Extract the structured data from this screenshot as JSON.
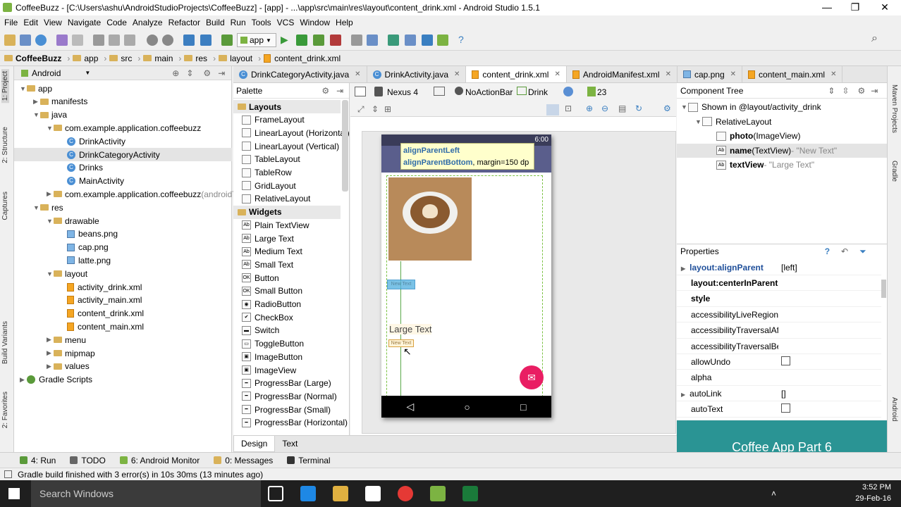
{
  "window": {
    "title": "CoffeeBuzz - [C:\\Users\\ashu\\AndroidStudioProjects\\CoffeeBuzz] - [app] - ...\\app\\src\\main\\res\\layout\\content_drink.xml - Android Studio 1.5.1",
    "minimize": "—",
    "maximize": "❐",
    "close": "✕"
  },
  "menu": [
    "File",
    "Edit",
    "View",
    "Navigate",
    "Code",
    "Analyze",
    "Refactor",
    "Build",
    "Run",
    "Tools",
    "VCS",
    "Window",
    "Help"
  ],
  "toolbar": {
    "run_config": "app"
  },
  "breadcrumb": [
    "CoffeeBuzz",
    "app",
    "src",
    "main",
    "res",
    "layout",
    "content_drink.xml"
  ],
  "left_tool_tabs": [
    "1: Project",
    "2: Structure",
    "Captures",
    "Build Variants",
    "2: Favorites"
  ],
  "right_tool_tabs": [
    "Maven Projects",
    "Gradle",
    "Android"
  ],
  "project": {
    "view": "Android",
    "tree": [
      {
        "label": "app",
        "depth": 0,
        "kind": "folder",
        "arrow": "▼"
      },
      {
        "label": "manifests",
        "depth": 1,
        "kind": "folder",
        "arrow": "▶"
      },
      {
        "label": "java",
        "depth": 1,
        "kind": "folder",
        "arrow": "▼"
      },
      {
        "label": "com.example.application.coffeebuzz",
        "depth": 2,
        "kind": "folder",
        "arrow": "▼"
      },
      {
        "label": "DrinkActivity",
        "depth": 3,
        "kind": "class",
        "arrow": ""
      },
      {
        "label": "DrinkCategoryActivity",
        "depth": 3,
        "kind": "class",
        "arrow": "",
        "selected": true
      },
      {
        "label": "Drinks",
        "depth": 3,
        "kind": "class",
        "arrow": ""
      },
      {
        "label": "MainActivity",
        "depth": 3,
        "kind": "class",
        "arrow": ""
      },
      {
        "label": "com.example.application.coffeebuzz",
        "suffix": " (androidTest)",
        "depth": 2,
        "kind": "folder",
        "arrow": "▶"
      },
      {
        "label": "res",
        "depth": 1,
        "kind": "folder",
        "arrow": "▼"
      },
      {
        "label": "drawable",
        "depth": 2,
        "kind": "folder",
        "arrow": "▼"
      },
      {
        "label": "beans.png",
        "depth": 3,
        "kind": "file",
        "arrow": ""
      },
      {
        "label": "cap.png",
        "depth": 3,
        "kind": "file",
        "arrow": ""
      },
      {
        "label": "latte.png",
        "depth": 3,
        "kind": "file",
        "arrow": ""
      },
      {
        "label": "layout",
        "depth": 2,
        "kind": "folder",
        "arrow": "▼"
      },
      {
        "label": "activity_drink.xml",
        "depth": 3,
        "kind": "xml",
        "arrow": ""
      },
      {
        "label": "activity_main.xml",
        "depth": 3,
        "kind": "xml",
        "arrow": ""
      },
      {
        "label": "content_drink.xml",
        "depth": 3,
        "kind": "xml",
        "arrow": ""
      },
      {
        "label": "content_main.xml",
        "depth": 3,
        "kind": "xml",
        "arrow": ""
      },
      {
        "label": "menu",
        "depth": 2,
        "kind": "folder",
        "arrow": "▶"
      },
      {
        "label": "mipmap",
        "depth": 2,
        "kind": "folder",
        "arrow": "▶"
      },
      {
        "label": "values",
        "depth": 2,
        "kind": "folder",
        "arrow": "▶"
      },
      {
        "label": "Gradle Scripts",
        "depth": 0,
        "kind": "gradle",
        "arrow": "▶"
      }
    ]
  },
  "editor_tabs": [
    {
      "label": "DrinkCategoryActivity.java",
      "active": false
    },
    {
      "label": "DrinkActivity.java",
      "active": false
    },
    {
      "label": "content_drink.xml",
      "active": true
    },
    {
      "label": "AndroidManifest.xml",
      "active": false
    },
    {
      "label": "cap.png",
      "active": false
    },
    {
      "label": "content_main.xml",
      "active": false
    }
  ],
  "palette": {
    "title": "Palette",
    "items": [
      {
        "label": "Layouts",
        "group": true
      },
      {
        "label": "FrameLayout"
      },
      {
        "label": "LinearLayout (Horizontal)"
      },
      {
        "label": "LinearLayout (Vertical)"
      },
      {
        "label": "TableLayout"
      },
      {
        "label": "TableRow"
      },
      {
        "label": "GridLayout"
      },
      {
        "label": "RelativeLayout"
      },
      {
        "label": "Widgets",
        "group": true
      },
      {
        "label": "Plain TextView",
        "icon": "Ab"
      },
      {
        "label": "Large Text",
        "icon": "Ab"
      },
      {
        "label": "Medium Text",
        "icon": "Ab"
      },
      {
        "label": "Small Text",
        "icon": "Ab"
      },
      {
        "label": "Button",
        "icon": "OK"
      },
      {
        "label": "Small Button",
        "icon": "OK"
      },
      {
        "label": "RadioButton",
        "icon": "◉"
      },
      {
        "label": "CheckBox",
        "icon": "✔"
      },
      {
        "label": "Switch",
        "icon": "▬"
      },
      {
        "label": "ToggleButton",
        "icon": "▭"
      },
      {
        "label": "ImageButton",
        "icon": "▣"
      },
      {
        "label": "ImageView",
        "icon": "▣"
      },
      {
        "label": "ProgressBar (Large)",
        "icon": "━"
      },
      {
        "label": "ProgressBar (Normal)",
        "icon": "━"
      },
      {
        "label": "ProgressBar (Small)",
        "icon": "━"
      },
      {
        "label": "ProgressBar (Horizontal)",
        "icon": "━"
      }
    ]
  },
  "canvas_toolbar": {
    "device": "Nexus 4",
    "theme": "NoActionBar",
    "activity": "Drink",
    "api": "23"
  },
  "phone": {
    "time": "6:00",
    "tooltip_line1": "alignParentLeft",
    "tooltip_line2_key": "alignParentBottom",
    "tooltip_line2_rest": ", margin=150 dp",
    "large_text": "Large Text",
    "small_text_1": "New Text",
    "small_text_2": "New Text",
    "nav_back": "◁",
    "nav_home": "○",
    "nav_recent": "□",
    "fab_icon": "✉"
  },
  "design_tabs": [
    "Design",
    "Text"
  ],
  "component_tree": {
    "title": "Component Tree",
    "rows": [
      {
        "label": "Shown in @layout/activity_drink",
        "depth": 0,
        "arrow": "▼"
      },
      {
        "label": "RelativeLayout",
        "depth": 1,
        "arrow": "▼"
      },
      {
        "label": "photo",
        "suffix": " (ImageView)",
        "hint": "",
        "depth": 2,
        "arrow": "",
        "bold": true
      },
      {
        "label": "name",
        "suffix": " (TextView)",
        "hint": " - \"New Text\"",
        "depth": 2,
        "arrow": "",
        "bold": true,
        "selected": true
      },
      {
        "label": "textView",
        "suffix": "",
        "hint": " - \"Large Text\"",
        "depth": 2,
        "arrow": "",
        "bold": true
      }
    ]
  },
  "properties": {
    "title": "Properties",
    "rows": [
      {
        "name": "layout:alignParent",
        "value": "[left]",
        "bold": true,
        "blue": true,
        "arrow": "▶"
      },
      {
        "name": "layout:centerInParent",
        "value": "",
        "bold": true
      },
      {
        "name": "style",
        "value": "",
        "bold": true
      },
      {
        "name": "accessibilityLiveRegion",
        "value": ""
      },
      {
        "name": "accessibilityTraversalAfte",
        "value": ""
      },
      {
        "name": "accessibilityTraversalBefc",
        "value": ""
      },
      {
        "name": "allowUndo",
        "value": "",
        "checkbox": true
      },
      {
        "name": "alpha",
        "value": ""
      },
      {
        "name": "autoLink",
        "value": "[]",
        "arrow": "▶"
      },
      {
        "name": "autoText",
        "value": "",
        "checkbox": true
      }
    ]
  },
  "overlay_caption": "Coffee App Part 6",
  "tool_windows": [
    {
      "label": "4: Run"
    },
    {
      "label": "TODO"
    },
    {
      "label": "6: Android Monitor"
    },
    {
      "label": "0: Messages"
    },
    {
      "label": "Terminal"
    }
  ],
  "status_message": "Gradle build finished with 3 error(s) in 10s 30ms (13 minutes ago)",
  "taskbar": {
    "search": "Search Windows",
    "time": "3:52 PM",
    "date": "29-Feb-16"
  },
  "colors": {
    "accent_fab": "#e91e63",
    "appbar": "#5a5e8c",
    "overlay": "#2a9494"
  }
}
